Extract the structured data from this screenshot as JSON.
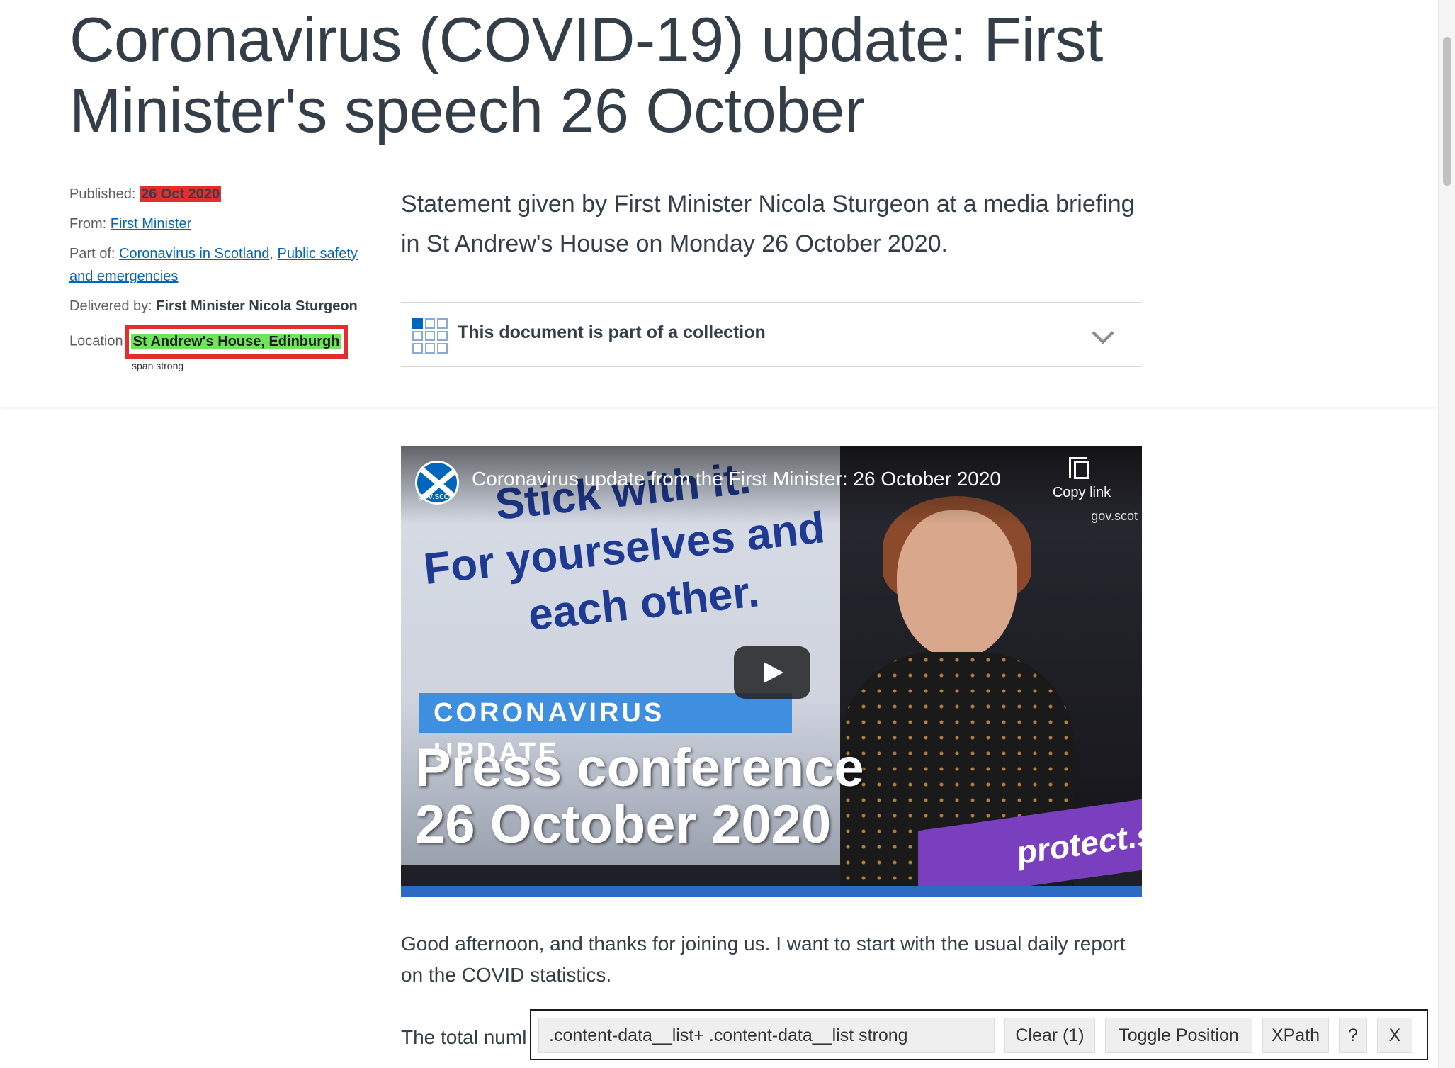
{
  "page": {
    "title": "Coronavirus (COVID-19) update: First Minister's speech 26 October",
    "summary": "Statement given by First Minister Nicola Sturgeon at a media briefing in St Andrew's House on Monday 26 October 2020."
  },
  "meta": {
    "published_label": "Published:",
    "published_value": "26 Oct 2020",
    "from_label": "From:",
    "from_link": "First Minister",
    "part_of_label": "Part of:",
    "part_of_link1": "Coronavirus in Scotland",
    "part_of_sep": ",",
    "part_of_link2": "Public safety and emergencies",
    "delivered_label": "Delivered by:",
    "delivered_value": "First Minister Nicola Sturgeon",
    "location_label": "Location",
    "location_value": "St Andrew's House, Edinburgh",
    "hint_label": "span strong"
  },
  "collection": {
    "title": "This document is part of a collection",
    "icon": "grid-icon"
  },
  "video": {
    "title": "Coronavirus update from the First Minister: 26 October 2020",
    "logo_text": "gov.scot",
    "copy_label": "Copy link",
    "brand": "gov.scot",
    "slogan_1": "Stick with it.",
    "slogan_2": "For yourselves and",
    "slogan_3": "each other.",
    "banner": "CORONAVIRUS UPDATE",
    "press_1": "Press conference",
    "press_2": "26 October 2020",
    "lectern_text": "protect.sc"
  },
  "body": {
    "para1": "Good afternoon, and thanks for joining us. I want to start with the usual daily report on the COVID statistics.",
    "para2": "The total numl"
  },
  "tool": {
    "selector": ".content-data__list+ .content-data__list strong",
    "clear_label": "Clear (1)",
    "toggle_label": "Toggle Position",
    "xpath_label": "XPath",
    "help_label": "?",
    "close_label": "X"
  },
  "colors": {
    "link": "#0065bd",
    "highlight_red": "#e22e2e",
    "highlight_green": "#6fe35a",
    "banner_blue": "#3f8fe0"
  }
}
